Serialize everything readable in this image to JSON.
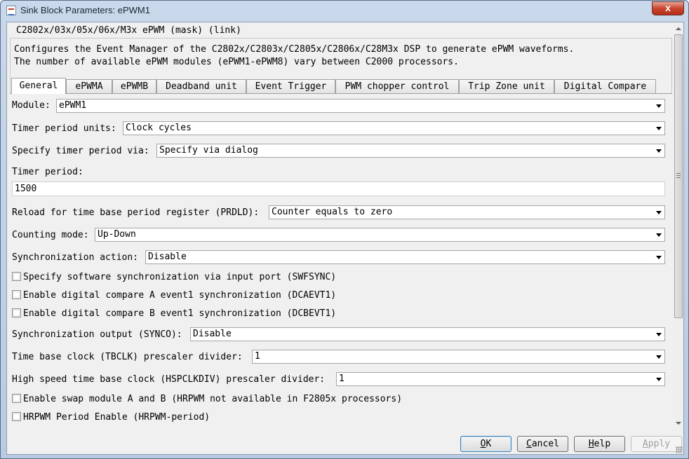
{
  "window": {
    "title": "Sink Block Parameters: ePWM1",
    "close_glyph": "x"
  },
  "mask": {
    "header": "C2802x/03x/05x/06x/M3x ePWM (mask) (link)",
    "description": [
      "Configures the Event Manager of the C2802x/C2803x/C2805x/C2806x/C28M3x DSP to generate ePWM waveforms.",
      "The number of available ePWM modules (ePWM1-ePWM8) vary between C2000 processors."
    ]
  },
  "tabs": [
    {
      "label": "General",
      "active": true
    },
    {
      "label": "ePWMA"
    },
    {
      "label": "ePWMB"
    },
    {
      "label": "Deadband unit"
    },
    {
      "label": "Event Trigger"
    },
    {
      "label": "PWM chopper control"
    },
    {
      "label": "Trip Zone unit"
    },
    {
      "label": "Digital Compare"
    }
  ],
  "general": {
    "module": {
      "label": "Module:",
      "value": "ePWM1"
    },
    "timer_period_units": {
      "label": "Timer period units:",
      "value": "Clock cycles"
    },
    "specify_timer_period": {
      "label": "Specify timer period via:",
      "value": "Specify via dialog"
    },
    "timer_period": {
      "label": "Timer period:",
      "value": "1500"
    },
    "reload_prdld": {
      "label": "Reload for time base period register (PRDLD):",
      "value": "Counter equals to zero"
    },
    "counting_mode": {
      "label": "Counting mode:",
      "value": "Up-Down"
    },
    "sync_action": {
      "label": "Synchronization action:",
      "value": "Disable"
    },
    "check_swfsync": {
      "label": "Specify software synchronization via input port (SWFSYNC)",
      "checked": false
    },
    "check_dcaevt1": {
      "label": "Enable digital compare A event1 synchronization (DCAEVT1)",
      "checked": false
    },
    "check_dcbevt1": {
      "label": "Enable digital compare B event1 synchronization (DCBEVT1)",
      "checked": false
    },
    "sync_output": {
      "label": "Synchronization output (SYNCO):",
      "value": "Disable"
    },
    "tbclk_prescaler": {
      "label": "Time base clock (TBCLK) prescaler divider:",
      "value": "1"
    },
    "hspclkdiv_prescaler": {
      "label": "High speed time base clock (HSPCLKDIV) prescaler divider:",
      "value": "1"
    },
    "check_swap": {
      "label": "Enable swap module A and B (HRPWM not available in F2805x processors)",
      "checked": false
    },
    "check_hrpwm_period": {
      "label": "HRPWM Period Enable (HRPWM-period)",
      "checked": false
    }
  },
  "buttons": {
    "ok": {
      "mnemonic": "O",
      "rest": "K"
    },
    "cancel": {
      "mnemonic": "C",
      "rest": "ancel"
    },
    "help": {
      "mnemonic": "H",
      "rest": "elp"
    },
    "apply": {
      "mnemonic": "A",
      "rest": "pply"
    }
  }
}
